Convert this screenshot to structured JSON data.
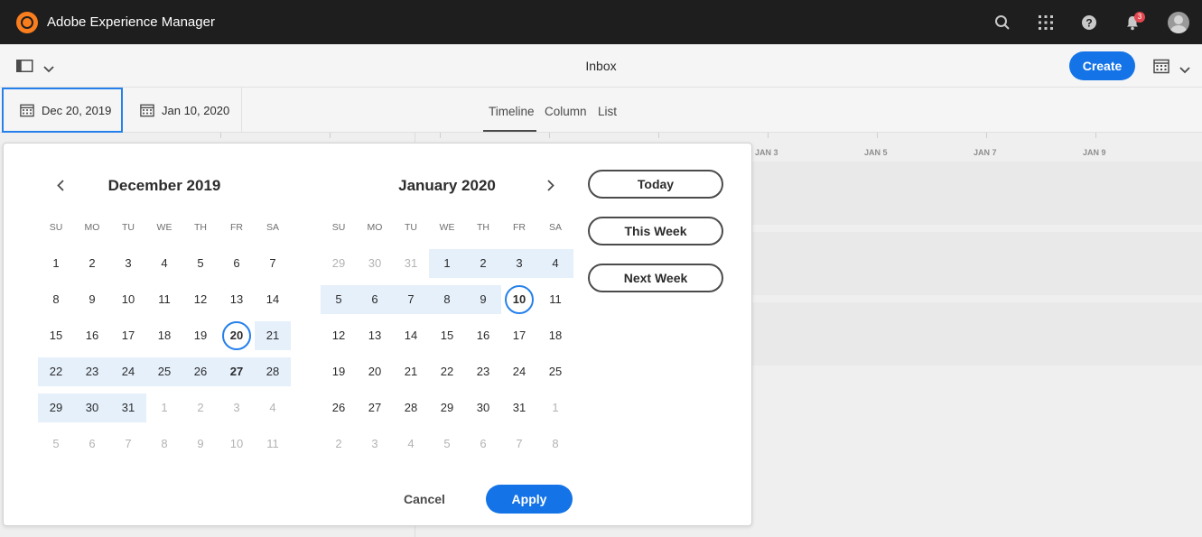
{
  "app": {
    "title": "Adobe Experience Manager",
    "notifications_count": "3"
  },
  "topbar_icons": [
    "search-icon",
    "apps-grid-icon",
    "help-icon",
    "bell-icon",
    "avatar"
  ],
  "actionbar": {
    "page_title": "Inbox",
    "create_label": "Create"
  },
  "datebar": {
    "start_date": "Dec 20, 2019",
    "end_date": "Jan 10, 2020",
    "tabs": [
      "Timeline",
      "Column",
      "List"
    ],
    "active_tab": "Timeline"
  },
  "timeline": {
    "labels": [
      "JAN 3",
      "JAN 5",
      "JAN 7",
      "JAN 9"
    ]
  },
  "calendar": {
    "weekdays": [
      "SU",
      "MO",
      "TU",
      "WE",
      "TH",
      "FR",
      "SA"
    ],
    "months": [
      {
        "title": "December 2019",
        "weeks": [
          [
            "1",
            "2",
            "3",
            "4",
            "5",
            "6",
            "7"
          ],
          [
            "8",
            "9",
            "10",
            "11",
            "12",
            "13",
            "14"
          ],
          [
            "15",
            "16",
            "17",
            "18",
            "19",
            "20",
            "21"
          ],
          [
            "22",
            "23",
            "24",
            "25",
            "26",
            "27",
            "28"
          ],
          [
            "29",
            "30",
            "31",
            "1",
            "2",
            "3",
            "4"
          ],
          [
            "5",
            "6",
            "7",
            "8",
            "9",
            "10",
            "11"
          ]
        ]
      },
      {
        "title": "January 2020",
        "weeks": [
          [
            "29",
            "30",
            "31",
            "1",
            "2",
            "3",
            "4"
          ],
          [
            "5",
            "6",
            "7",
            "8",
            "9",
            "10",
            "11"
          ],
          [
            "12",
            "13",
            "14",
            "15",
            "16",
            "17",
            "18"
          ],
          [
            "19",
            "20",
            "21",
            "22",
            "23",
            "24",
            "25"
          ],
          [
            "26",
            "27",
            "28",
            "29",
            "30",
            "31",
            "1"
          ],
          [
            "2",
            "3",
            "4",
            "5",
            "6",
            "7",
            "8"
          ]
        ]
      }
    ],
    "presets": [
      "Today",
      "This Week",
      "Next Week"
    ],
    "cancel_label": "Cancel",
    "apply_label": "Apply"
  },
  "colors": {
    "accent": "#1473e6",
    "range": "#e5f0fb",
    "topbar": "#1e1e1e"
  }
}
